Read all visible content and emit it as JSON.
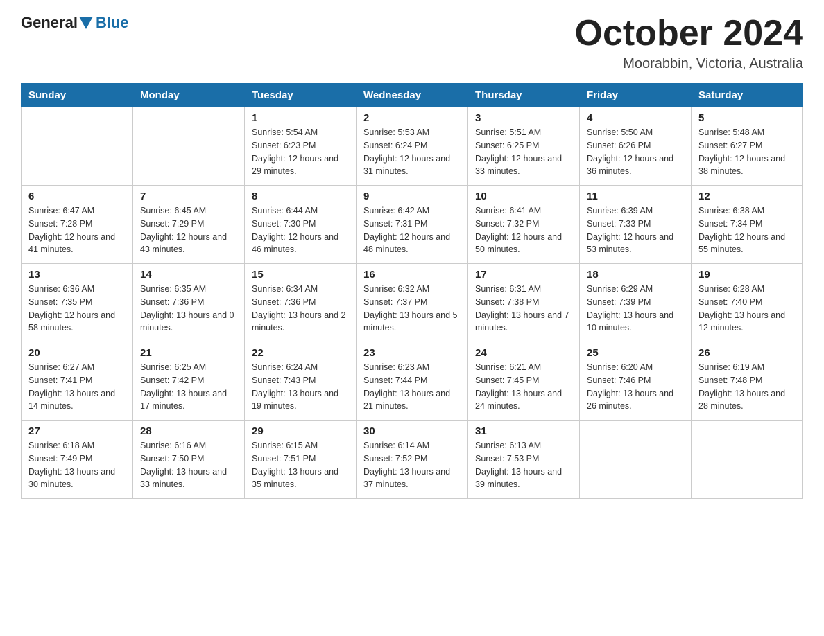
{
  "header": {
    "logo_general": "General",
    "logo_blue": "Blue",
    "title": "October 2024",
    "location": "Moorabbin, Victoria, Australia"
  },
  "weekdays": [
    "Sunday",
    "Monday",
    "Tuesday",
    "Wednesday",
    "Thursday",
    "Friday",
    "Saturday"
  ],
  "weeks": [
    [
      null,
      null,
      {
        "day": "1",
        "sunrise": "Sunrise: 5:54 AM",
        "sunset": "Sunset: 6:23 PM",
        "daylight": "Daylight: 12 hours and 29 minutes."
      },
      {
        "day": "2",
        "sunrise": "Sunrise: 5:53 AM",
        "sunset": "Sunset: 6:24 PM",
        "daylight": "Daylight: 12 hours and 31 minutes."
      },
      {
        "day": "3",
        "sunrise": "Sunrise: 5:51 AM",
        "sunset": "Sunset: 6:25 PM",
        "daylight": "Daylight: 12 hours and 33 minutes."
      },
      {
        "day": "4",
        "sunrise": "Sunrise: 5:50 AM",
        "sunset": "Sunset: 6:26 PM",
        "daylight": "Daylight: 12 hours and 36 minutes."
      },
      {
        "day": "5",
        "sunrise": "Sunrise: 5:48 AM",
        "sunset": "Sunset: 6:27 PM",
        "daylight": "Daylight: 12 hours and 38 minutes."
      }
    ],
    [
      {
        "day": "6",
        "sunrise": "Sunrise: 6:47 AM",
        "sunset": "Sunset: 7:28 PM",
        "daylight": "Daylight: 12 hours and 41 minutes."
      },
      {
        "day": "7",
        "sunrise": "Sunrise: 6:45 AM",
        "sunset": "Sunset: 7:29 PM",
        "daylight": "Daylight: 12 hours and 43 minutes."
      },
      {
        "day": "8",
        "sunrise": "Sunrise: 6:44 AM",
        "sunset": "Sunset: 7:30 PM",
        "daylight": "Daylight: 12 hours and 46 minutes."
      },
      {
        "day": "9",
        "sunrise": "Sunrise: 6:42 AM",
        "sunset": "Sunset: 7:31 PM",
        "daylight": "Daylight: 12 hours and 48 minutes."
      },
      {
        "day": "10",
        "sunrise": "Sunrise: 6:41 AM",
        "sunset": "Sunset: 7:32 PM",
        "daylight": "Daylight: 12 hours and 50 minutes."
      },
      {
        "day": "11",
        "sunrise": "Sunrise: 6:39 AM",
        "sunset": "Sunset: 7:33 PM",
        "daylight": "Daylight: 12 hours and 53 minutes."
      },
      {
        "day": "12",
        "sunrise": "Sunrise: 6:38 AM",
        "sunset": "Sunset: 7:34 PM",
        "daylight": "Daylight: 12 hours and 55 minutes."
      }
    ],
    [
      {
        "day": "13",
        "sunrise": "Sunrise: 6:36 AM",
        "sunset": "Sunset: 7:35 PM",
        "daylight": "Daylight: 12 hours and 58 minutes."
      },
      {
        "day": "14",
        "sunrise": "Sunrise: 6:35 AM",
        "sunset": "Sunset: 7:36 PM",
        "daylight": "Daylight: 13 hours and 0 minutes."
      },
      {
        "day": "15",
        "sunrise": "Sunrise: 6:34 AM",
        "sunset": "Sunset: 7:36 PM",
        "daylight": "Daylight: 13 hours and 2 minutes."
      },
      {
        "day": "16",
        "sunrise": "Sunrise: 6:32 AM",
        "sunset": "Sunset: 7:37 PM",
        "daylight": "Daylight: 13 hours and 5 minutes."
      },
      {
        "day": "17",
        "sunrise": "Sunrise: 6:31 AM",
        "sunset": "Sunset: 7:38 PM",
        "daylight": "Daylight: 13 hours and 7 minutes."
      },
      {
        "day": "18",
        "sunrise": "Sunrise: 6:29 AM",
        "sunset": "Sunset: 7:39 PM",
        "daylight": "Daylight: 13 hours and 10 minutes."
      },
      {
        "day": "19",
        "sunrise": "Sunrise: 6:28 AM",
        "sunset": "Sunset: 7:40 PM",
        "daylight": "Daylight: 13 hours and 12 minutes."
      }
    ],
    [
      {
        "day": "20",
        "sunrise": "Sunrise: 6:27 AM",
        "sunset": "Sunset: 7:41 PM",
        "daylight": "Daylight: 13 hours and 14 minutes."
      },
      {
        "day": "21",
        "sunrise": "Sunrise: 6:25 AM",
        "sunset": "Sunset: 7:42 PM",
        "daylight": "Daylight: 13 hours and 17 minutes."
      },
      {
        "day": "22",
        "sunrise": "Sunrise: 6:24 AM",
        "sunset": "Sunset: 7:43 PM",
        "daylight": "Daylight: 13 hours and 19 minutes."
      },
      {
        "day": "23",
        "sunrise": "Sunrise: 6:23 AM",
        "sunset": "Sunset: 7:44 PM",
        "daylight": "Daylight: 13 hours and 21 minutes."
      },
      {
        "day": "24",
        "sunrise": "Sunrise: 6:21 AM",
        "sunset": "Sunset: 7:45 PM",
        "daylight": "Daylight: 13 hours and 24 minutes."
      },
      {
        "day": "25",
        "sunrise": "Sunrise: 6:20 AM",
        "sunset": "Sunset: 7:46 PM",
        "daylight": "Daylight: 13 hours and 26 minutes."
      },
      {
        "day": "26",
        "sunrise": "Sunrise: 6:19 AM",
        "sunset": "Sunset: 7:48 PM",
        "daylight": "Daylight: 13 hours and 28 minutes."
      }
    ],
    [
      {
        "day": "27",
        "sunrise": "Sunrise: 6:18 AM",
        "sunset": "Sunset: 7:49 PM",
        "daylight": "Daylight: 13 hours and 30 minutes."
      },
      {
        "day": "28",
        "sunrise": "Sunrise: 6:16 AM",
        "sunset": "Sunset: 7:50 PM",
        "daylight": "Daylight: 13 hours and 33 minutes."
      },
      {
        "day": "29",
        "sunrise": "Sunrise: 6:15 AM",
        "sunset": "Sunset: 7:51 PM",
        "daylight": "Daylight: 13 hours and 35 minutes."
      },
      {
        "day": "30",
        "sunrise": "Sunrise: 6:14 AM",
        "sunset": "Sunset: 7:52 PM",
        "daylight": "Daylight: 13 hours and 37 minutes."
      },
      {
        "day": "31",
        "sunrise": "Sunrise: 6:13 AM",
        "sunset": "Sunset: 7:53 PM",
        "daylight": "Daylight: 13 hours and 39 minutes."
      },
      null,
      null
    ]
  ]
}
